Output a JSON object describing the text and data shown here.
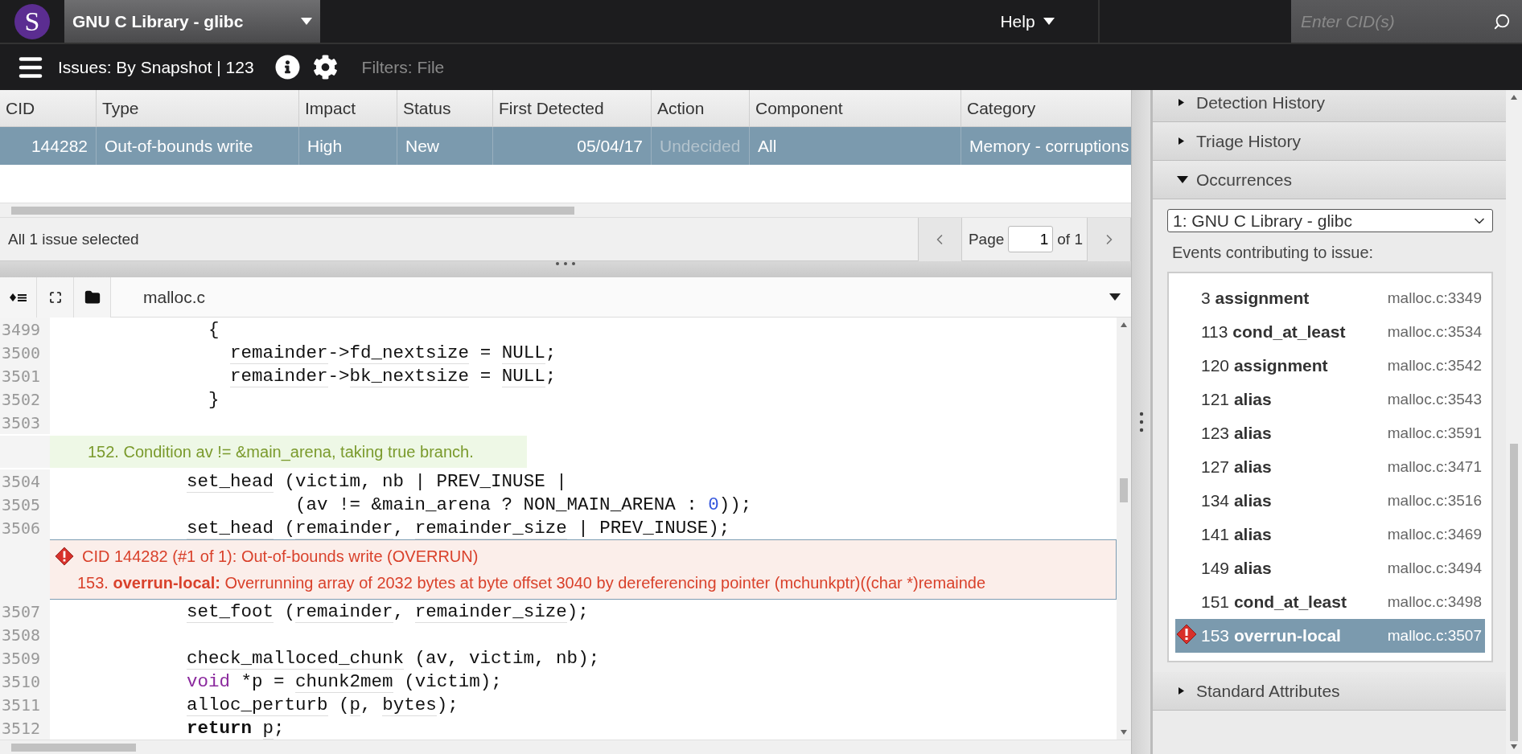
{
  "top_bar": {
    "logo_letter": "S",
    "project": "GNU C Library - glibc",
    "help": "Help",
    "search": {
      "placeholder": "Enter CID(s)"
    }
  },
  "sub_bar": {
    "view": "Issues: By Snapshot | 123",
    "filters": "Filters: File"
  },
  "table": {
    "columns": [
      "CID",
      "Type",
      "Impact",
      "Status",
      "First Detected",
      "Action",
      "Component",
      "Category"
    ],
    "rows": [
      {
        "selected": true,
        "cells": [
          {
            "text": "144282",
            "dim": false
          },
          {
            "text": "Out-of-bounds write",
            "dim": false
          },
          {
            "text": "High",
            "dim": false
          },
          {
            "text": "New",
            "dim": false
          },
          {
            "text": "05/04/17",
            "dim": false
          },
          {
            "text": "Undecided",
            "dim": true
          },
          {
            "text": "All",
            "dim": false
          },
          {
            "text": "Memory - corruptions",
            "dim": false
          }
        ]
      }
    ]
  },
  "table_footer": {
    "selection": "All 1 issue selected",
    "page_label": "Page",
    "page_value": "1",
    "page_total": "of 1"
  },
  "source": {
    "file": "malloc.c",
    "lines": [
      {
        "kind": "code",
        "number": "3499",
        "segments": [
          {
            "text": "              {",
            "kind": "plain"
          }
        ]
      },
      {
        "kind": "code",
        "number": "3500",
        "segments": [
          {
            "text": "                remainder",
            "kind": "id"
          },
          {
            "text": "->",
            "kind": "plain"
          },
          {
            "text": "fd_nextsize",
            "kind": "id"
          },
          {
            "text": " = ",
            "kind": "plain"
          },
          {
            "text": "NULL",
            "kind": "id"
          },
          {
            "text": ";",
            "kind": "plain"
          }
        ]
      },
      {
        "kind": "code",
        "number": "3501",
        "segments": [
          {
            "text": "                remainder",
            "kind": "id"
          },
          {
            "text": "->",
            "kind": "plain"
          },
          {
            "text": "bk_nextsize",
            "kind": "id"
          },
          {
            "text": " = ",
            "kind": "plain"
          },
          {
            "text": "NULL",
            "kind": "id"
          },
          {
            "text": ";",
            "kind": "plain"
          }
        ]
      },
      {
        "kind": "code",
        "number": "3502",
        "segments": [
          {
            "text": "              }",
            "kind": "plain"
          }
        ]
      },
      {
        "kind": "code",
        "number": "3503"
      },
      {
        "kind": "event",
        "text": "152. Condition av != &main_arena, taking true branch."
      },
      {
        "kind": "code",
        "number": "3504",
        "segments": [
          {
            "text": "            set_head",
            "kind": "id"
          },
          {
            "text": " (victim, nb | PREV_INUSE |",
            "kind": "plain"
          }
        ]
      },
      {
        "kind": "code",
        "number": "3505",
        "segments": [
          {
            "text": "                      (av != &main_arena ? NON_MAIN_ARENA : ",
            "kind": "plain"
          },
          {
            "text": "0",
            "kind": "num"
          },
          {
            "text": "));",
            "kind": "plain"
          }
        ]
      },
      {
        "kind": "code",
        "number": "3506",
        "segments": [
          {
            "text": "            set_head",
            "kind": "id"
          },
          {
            "text": " (",
            "kind": "plain"
          },
          {
            "text": "remainder",
            "kind": "id"
          },
          {
            "text": ", ",
            "kind": "plain"
          },
          {
            "text": "remainder_size",
            "kind": "id"
          },
          {
            "text": " | PREV_INUSE);",
            "kind": "plain"
          }
        ]
      },
      {
        "kind": "defect",
        "title": "CID 144282 (#1 of 1): Out-of-bounds write (OVERRUN)",
        "text": "153. **overrun-local:** Overrunning array of 2032 bytes at byte offset 3040 by dereferencing pointer (mchunkptr)((char *)remainde"
      },
      {
        "kind": "code",
        "number": "3507",
        "segments": [
          {
            "text": "            set_foot",
            "kind": "id"
          },
          {
            "text": " (",
            "kind": "plain"
          },
          {
            "text": "remainder",
            "kind": "id"
          },
          {
            "text": ", ",
            "kind": "plain"
          },
          {
            "text": "remainder_size",
            "kind": "id"
          },
          {
            "text": ");",
            "kind": "plain"
          }
        ]
      },
      {
        "kind": "code",
        "number": "3508"
      },
      {
        "kind": "code",
        "number": "3509",
        "segments": [
          {
            "text": "            check_malloced_chunk",
            "kind": "id"
          },
          {
            "text": " (av, victim, nb);",
            "kind": "plain"
          }
        ]
      },
      {
        "kind": "code",
        "number": "3510",
        "segments": [
          {
            "text": "            void",
            "kind": "keyword"
          },
          {
            "text": " *p = ",
            "kind": "plain"
          },
          {
            "text": "chunk2mem",
            "kind": "id"
          },
          {
            "text": " (victim);",
            "kind": "plain"
          }
        ]
      },
      {
        "kind": "code",
        "number": "3511",
        "segments": [
          {
            "text": "            alloc_perturb",
            "kind": "id"
          },
          {
            "text": " (",
            "kind": "plain"
          },
          {
            "text": "p",
            "kind": "id"
          },
          {
            "text": ", ",
            "kind": "plain"
          },
          {
            "text": "bytes",
            "kind": "id"
          },
          {
            "text": ");",
            "kind": "plain"
          }
        ]
      },
      {
        "kind": "code",
        "number": "3512",
        "segments": [
          {
            "text": "            return",
            "kind": "bold"
          },
          {
            "text": " p",
            "kind": "id"
          },
          {
            "text": ";",
            "kind": "plain"
          }
        ]
      }
    ]
  },
  "side_panel": {
    "sections": [
      {
        "title": "Detection History",
        "expanded": false
      },
      {
        "title": "Triage History",
        "expanded": false
      },
      {
        "title": "Occurrences",
        "expanded": true
      },
      {
        "title": "Standard Attributes",
        "expanded": false
      }
    ],
    "occurrence_select": "1: GNU C Library - glibc",
    "events_label": "Events contributing to issue:",
    "events": [
      {
        "number": "3",
        "name": "assignment",
        "location": "malloc.c:3349",
        "selected": false,
        "defect": false
      },
      {
        "number": "113",
        "name": "cond_at_least",
        "location": "malloc.c:3534",
        "selected": false,
        "defect": false
      },
      {
        "number": "120",
        "name": "assignment",
        "location": "malloc.c:3542",
        "selected": false,
        "defect": false
      },
      {
        "number": "121",
        "name": "alias",
        "location": "malloc.c:3543",
        "selected": false,
        "defect": false
      },
      {
        "number": "123",
        "name": "alias",
        "location": "malloc.c:3591",
        "selected": false,
        "defect": false
      },
      {
        "number": "127",
        "name": "alias",
        "location": "malloc.c:3471",
        "selected": false,
        "defect": false
      },
      {
        "number": "134",
        "name": "alias",
        "location": "malloc.c:3516",
        "selected": false,
        "defect": false
      },
      {
        "number": "141",
        "name": "alias",
        "location": "malloc.c:3469",
        "selected": false,
        "defect": false
      },
      {
        "number": "149",
        "name": "alias",
        "location": "malloc.c:3494",
        "selected": false,
        "defect": false
      },
      {
        "number": "151",
        "name": "cond_at_least",
        "location": "malloc.c:3498",
        "selected": false,
        "defect": false
      },
      {
        "number": "153",
        "name": "overrun-local",
        "location": "malloc.c:3507",
        "selected": true,
        "defect": true
      }
    ]
  }
}
